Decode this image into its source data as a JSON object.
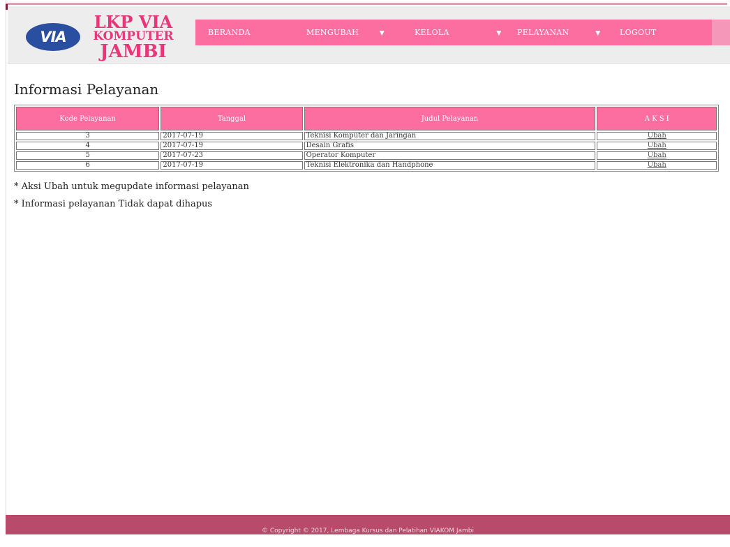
{
  "logo": {
    "emblem": "VIA",
    "line1": "LKP VIA",
    "line2": "KOMPUTER",
    "line3": "JAMBI"
  },
  "nav": {
    "items": [
      {
        "label": "BERANDA",
        "dropdown": false
      },
      {
        "label": "MENGUBAH",
        "dropdown": true
      },
      {
        "label": "KELOLA",
        "dropdown": true
      },
      {
        "label": "PELAYANAN",
        "dropdown": true
      },
      {
        "label": "LOGOUT",
        "dropdown": false
      }
    ],
    "caret_glyph": "▼",
    "bg_color": "#fd6ea0"
  },
  "page": {
    "title": "Informasi Pelayanan"
  },
  "table": {
    "headers": [
      "Kode Pelayanan",
      "Tanggal",
      "Judul Pelayanan",
      "A K S I"
    ],
    "rows": [
      {
        "kode": "3",
        "tanggal": "2017-07-19",
        "judul": "Teknisi Komputer dan Jaringan",
        "aksi": "Ubah"
      },
      {
        "kode": "4",
        "tanggal": "2017-07-19",
        "judul": "Desain Grafis",
        "aksi": "Ubah"
      },
      {
        "kode": "5",
        "tanggal": "2017-07-23",
        "judul": "Operator Komputer",
        "aksi": "Ubah"
      },
      {
        "kode": "6",
        "tanggal": "2017-07-19",
        "judul": "Teknisi Elektronika dan Handphone",
        "aksi": "Ubah"
      }
    ]
  },
  "notes": [
    "* Aksi Ubah untuk megupdate informasi pelayanan",
    "* Informasi pelayanan Tidak dapat dihapus"
  ],
  "footer": {
    "text": "© Copyright © 2017, Lembaga Kursus dan Pelatihan VIAKOM Jambi"
  },
  "colors": {
    "accent": "#fd6ea0",
    "footer": "#b84a6c",
    "logo_text": "#e8367a",
    "logo_emblem": "#2b4fa0"
  }
}
